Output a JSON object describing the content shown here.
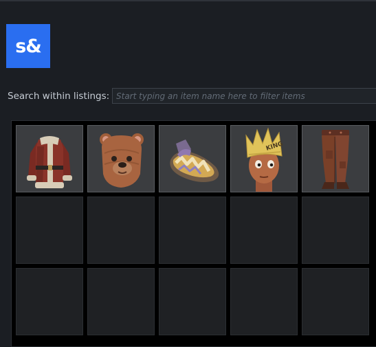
{
  "header": {
    "avatar_text": "s&",
    "avatar_color": "#2a6ef0"
  },
  "search": {
    "label": "Search within listings:",
    "placeholder": "Start typing an item name here to filter items",
    "value": ""
  },
  "items": [
    {
      "icon": "santa-jacket-icon"
    },
    {
      "icon": "bear-mask-icon"
    },
    {
      "icon": "slippers-icon"
    },
    {
      "icon": "paper-crown-icon",
      "crown_text": "KING"
    },
    {
      "icon": "brown-pants-icon"
    }
  ],
  "empty_slots": 10
}
